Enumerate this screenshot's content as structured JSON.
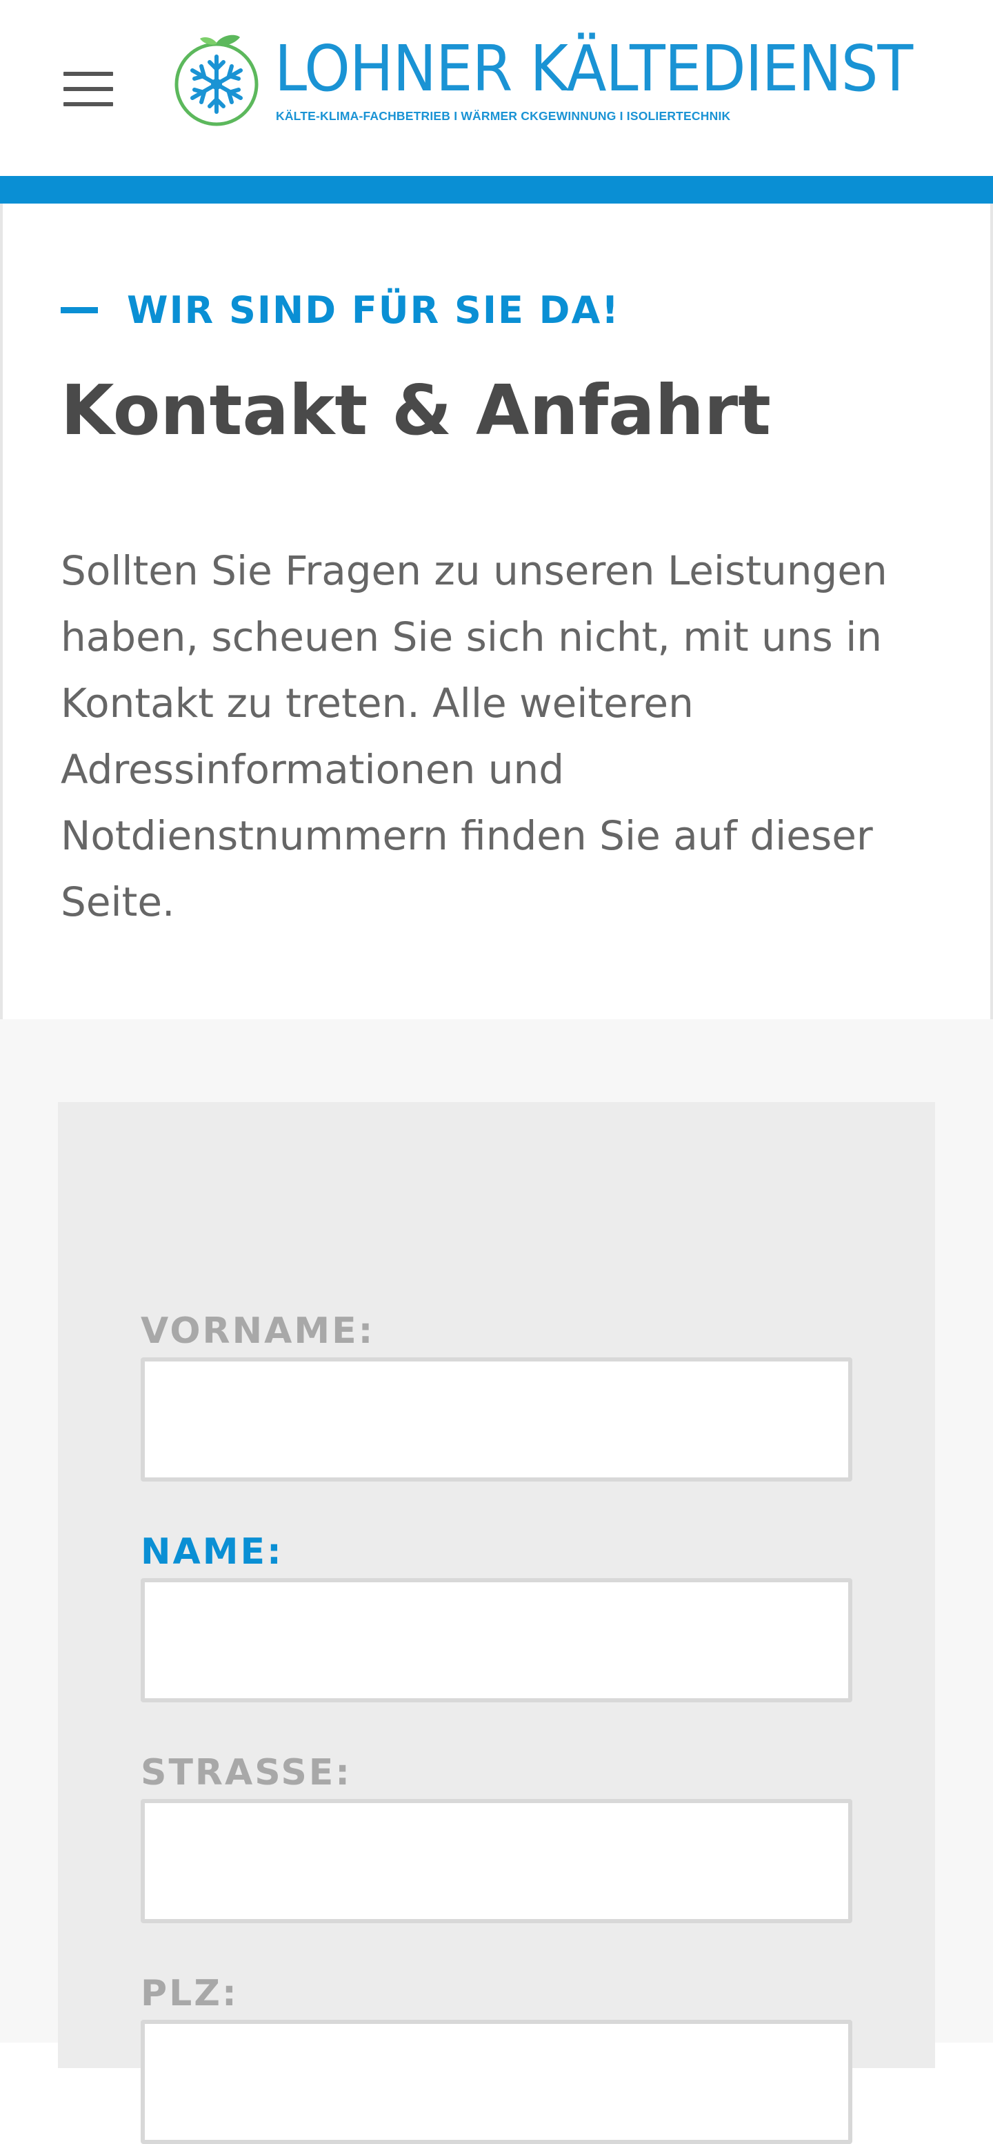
{
  "header": {
    "menu_icon": "hamburger-menu-icon",
    "logo": {
      "title": "LOHNER KÄLTEDIENST",
      "tagline": "KÄLTE-KLIMA-FACHBETRIEB I WÄRMER   CKGEWINNUNG I ISOLIERTECHNIK",
      "badge_icon": "snowflake-leaf-icon"
    },
    "accent_color": "#0a8fd4"
  },
  "intro": {
    "kicker": "WIR SIND FÜR SIE DA!",
    "title": "Kontakt & Anfahrt",
    "text": "Sollten Sie Fragen zu unseren Leistungen haben, scheuen Sie sich nicht, mit uns in Kontakt zu treten. Alle weiteren Adressinformationen und Notdienstnummern finden Sie auf dieser Seite."
  },
  "form": {
    "fields": [
      {
        "label": "VORNAME:",
        "value": "",
        "active": false
      },
      {
        "label": "NAME:",
        "value": "",
        "active": true
      },
      {
        "label": "STRASSE:",
        "value": "",
        "active": false
      },
      {
        "label": "PLZ:",
        "value": "",
        "active": false
      }
    ]
  }
}
